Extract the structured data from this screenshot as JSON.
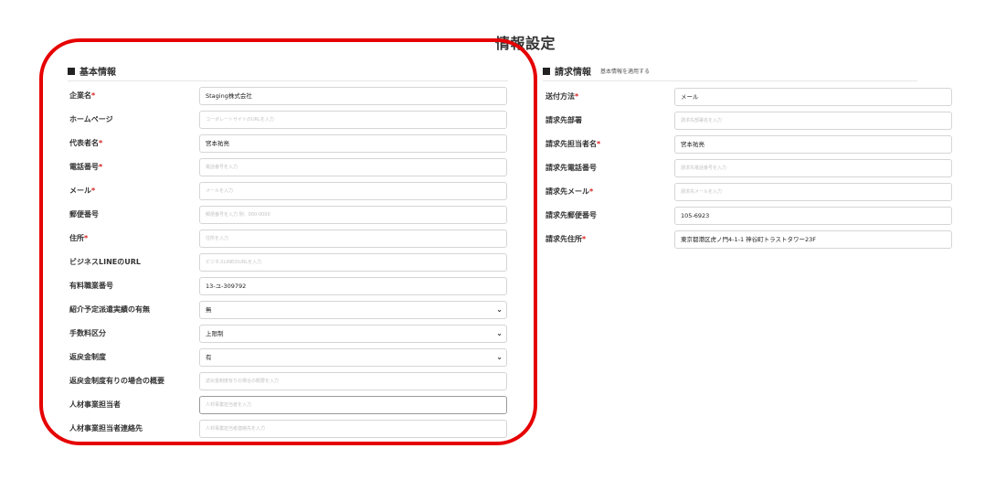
{
  "page": {
    "title": "情報設定"
  },
  "basic": {
    "heading": "基本情報",
    "fields": [
      {
        "label": "企業名",
        "required": "*",
        "value": "Staging株式会社",
        "placeholder": ""
      },
      {
        "label": "ホームページ",
        "required": "",
        "value": "",
        "placeholder": "コーポレートサイトのURLを入力"
      },
      {
        "label": "代表者名",
        "required": "*",
        "value": "宮本祐亮",
        "placeholder": ""
      },
      {
        "label": "電話番号",
        "required": "*",
        "value": "",
        "placeholder": "電話番号を入力"
      },
      {
        "label": "メール",
        "required": "*",
        "value": "",
        "placeholder": "メールを入力"
      },
      {
        "label": "郵便番号",
        "required": "",
        "value": "",
        "placeholder": "郵便番号を入力 例：000-0000"
      },
      {
        "label": "住所",
        "required": "*",
        "value": "",
        "placeholder": "住所を入力"
      },
      {
        "label": "ビジネスLINEのURL",
        "required": "",
        "value": "",
        "placeholder": "ビジネスLINEのURLを入力"
      },
      {
        "label": "有料職業番号",
        "required": "",
        "value": "13-ユ-309792",
        "placeholder": ""
      },
      {
        "label": "紹介予定派遣実績の有無",
        "required": "",
        "value": "無",
        "placeholder": ""
      },
      {
        "label": "手数料区分",
        "required": "",
        "value": "上限制",
        "placeholder": ""
      },
      {
        "label": "返戻金制度",
        "required": "",
        "value": "有",
        "placeholder": ""
      },
      {
        "label": "返戻金制度有りの場合の概要",
        "required": "",
        "value": "",
        "placeholder": "返戻金制度有りの場合の概要を入力"
      },
      {
        "label": "人材事業担当者",
        "required": "",
        "value": "",
        "placeholder": "人材事業担当者を入力"
      },
      {
        "label": "人材事業担当者連絡先",
        "required": "",
        "value": "",
        "placeholder": "人材事業担当者連絡先を入力"
      }
    ]
  },
  "billing": {
    "heading": "請求情報",
    "sub": "基本情報を適用する",
    "fields": [
      {
        "label": "送付方法",
        "required": "*",
        "value": "メール",
        "placeholder": ""
      },
      {
        "label": "請求先部署",
        "required": "",
        "value": "",
        "placeholder": "請求先部署名を入力"
      },
      {
        "label": "請求先担当者名",
        "required": "*",
        "value": "宮本祐亮",
        "placeholder": ""
      },
      {
        "label": "請求先電話番号",
        "required": "",
        "value": "",
        "placeholder": "請求先電話番号を入力"
      },
      {
        "label": "請求先メール",
        "required": "*",
        "value": "",
        "placeholder": "請求先メールを入力"
      },
      {
        "label": "請求先郵便番号",
        "required": "",
        "value": "105-6923",
        "placeholder": ""
      },
      {
        "label": "請求先住所",
        "required": "*",
        "value": "東京都港区虎ノ門4-1-1 神谷町トラストタワー23F",
        "placeholder": ""
      }
    ]
  },
  "colors": {
    "required": "#d81b1b",
    "highlight": "#e60000"
  }
}
